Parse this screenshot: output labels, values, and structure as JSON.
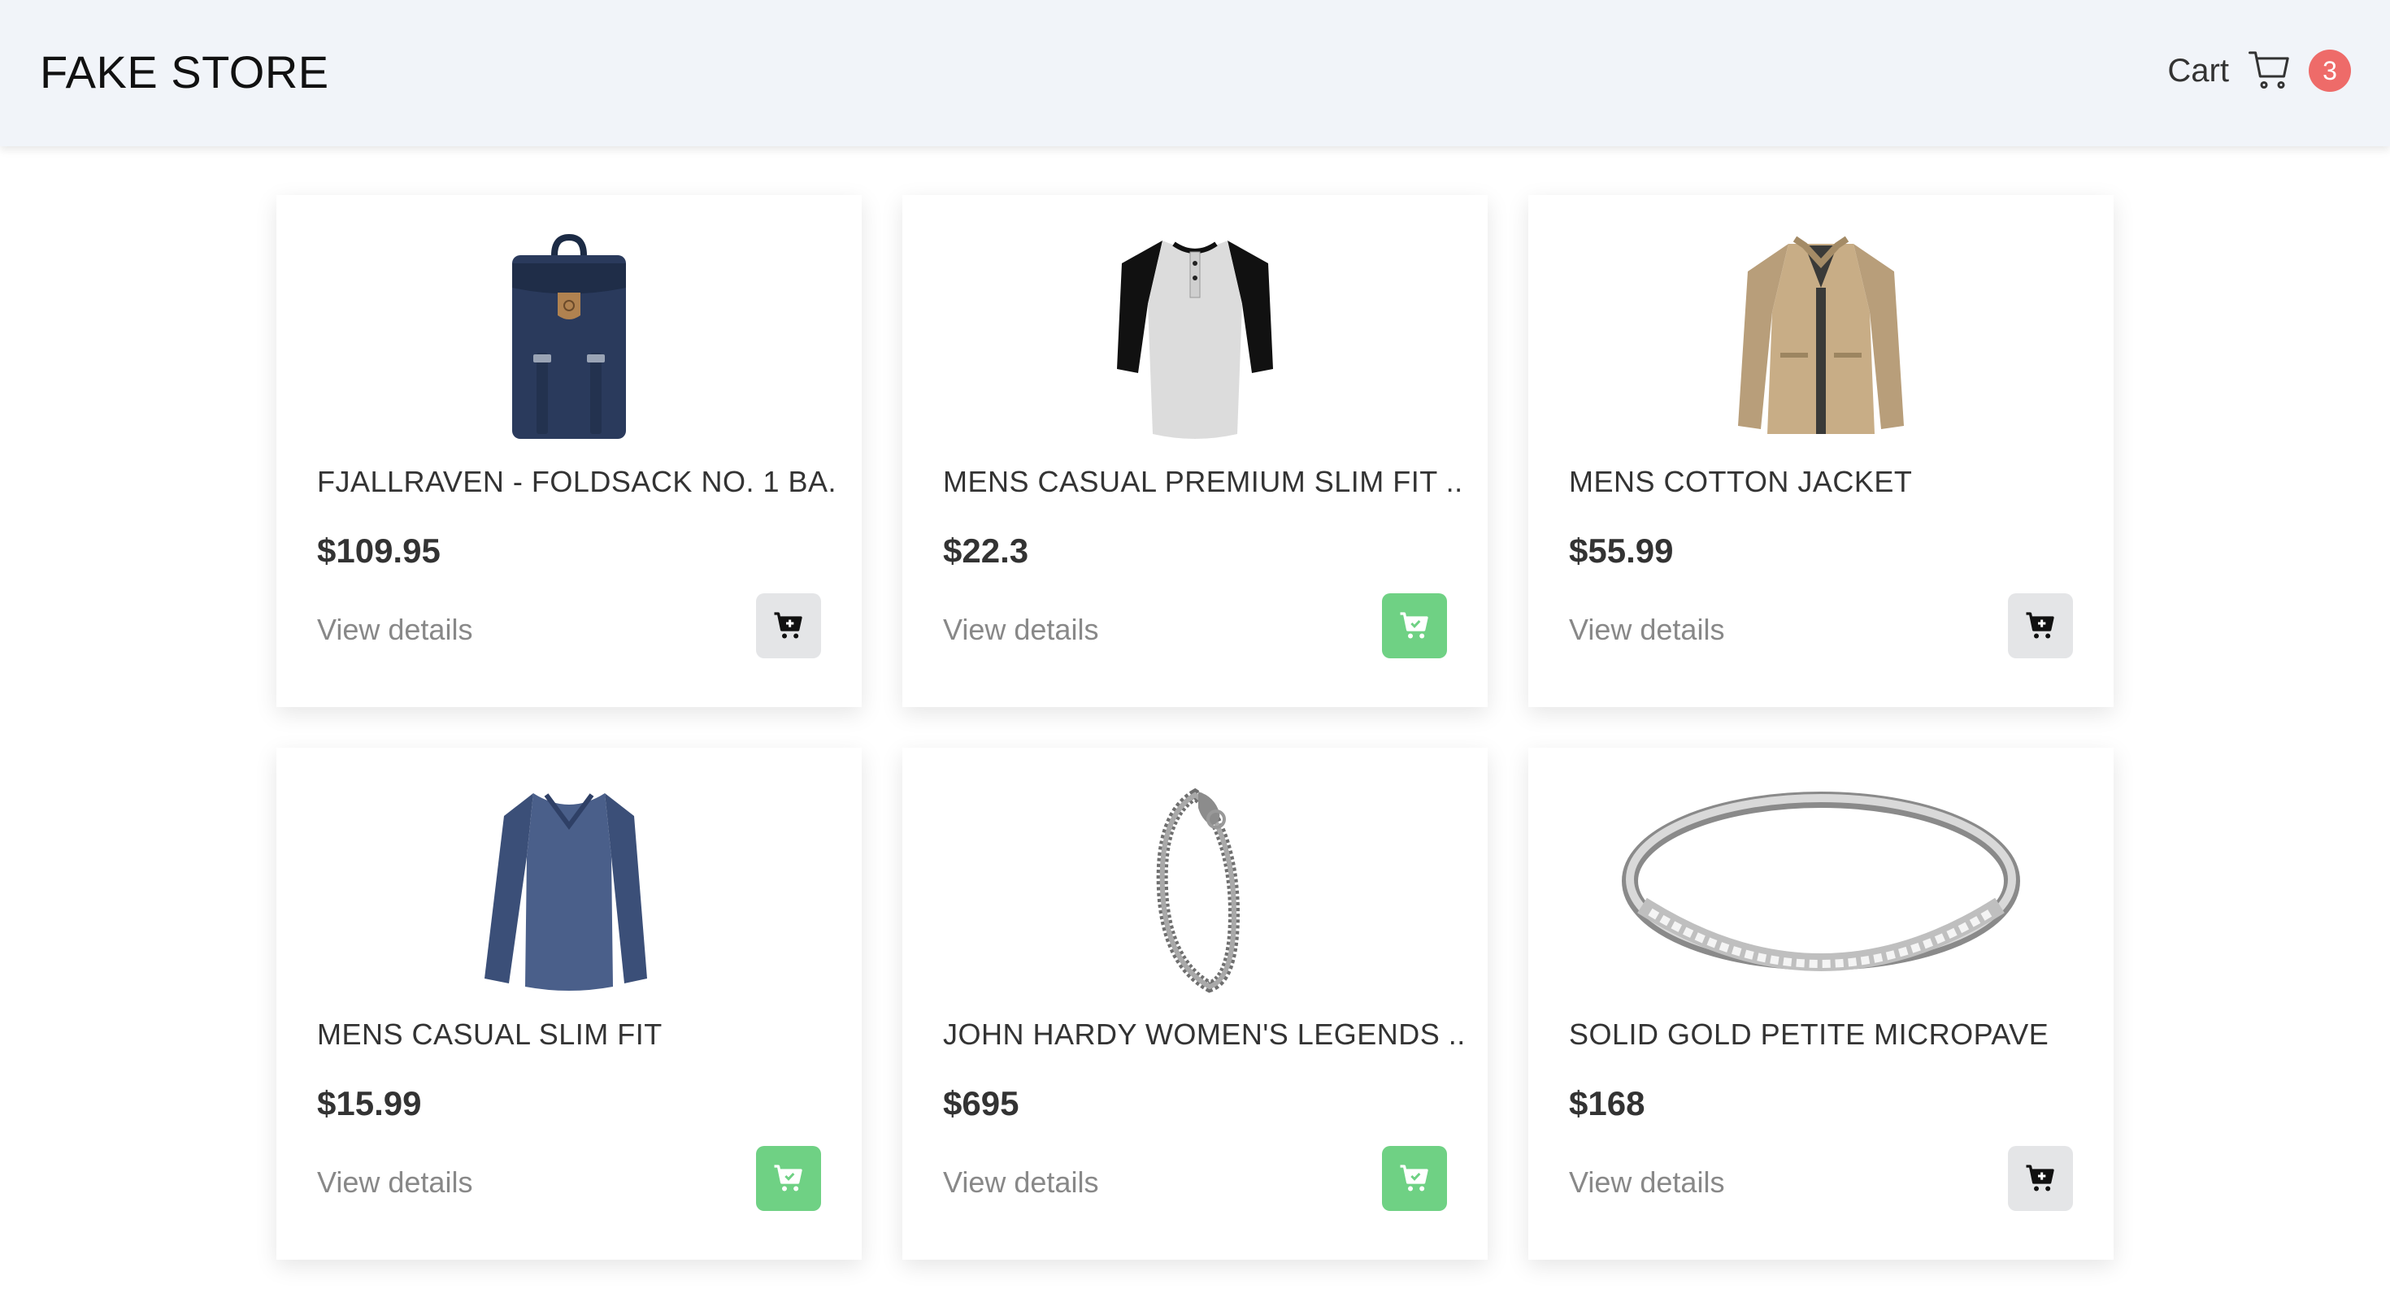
{
  "header": {
    "brand": "FAKE STORE",
    "cart_label": "Cart",
    "cart_count": "3",
    "cart_icon": "cart-outline-icon"
  },
  "products": [
    {
      "title": "FJALLRAVEN - FOLDSACK NO. 1 BA...",
      "price": "$109.95",
      "link": "View details",
      "in_cart": false,
      "image": "backpack"
    },
    {
      "title": "MENS CASUAL PREMIUM SLIM FIT ...",
      "price": "$22.3",
      "link": "View details",
      "in_cart": true,
      "image": "henley-shirt"
    },
    {
      "title": "MENS COTTON JACKET",
      "price": "$55.99",
      "link": "View details",
      "in_cart": false,
      "image": "jacket"
    },
    {
      "title": "MENS CASUAL SLIM FIT",
      "price": "$15.99",
      "link": "View details",
      "in_cart": true,
      "image": "long-sleeve-shirt"
    },
    {
      "title": "JOHN HARDY WOMEN'S LEGENDS ...",
      "price": "$695",
      "link": "View details",
      "in_cart": true,
      "image": "bracelet"
    },
    {
      "title": "SOLID GOLD PETITE MICROPAVE",
      "price": "$168",
      "link": "View details",
      "in_cart": false,
      "image": "ring"
    }
  ],
  "colors": {
    "header_bg": "#f1f4f9",
    "badge": "#ee6b69",
    "in_cart_button": "#6fd184",
    "add_button": "#e4e5e7"
  }
}
